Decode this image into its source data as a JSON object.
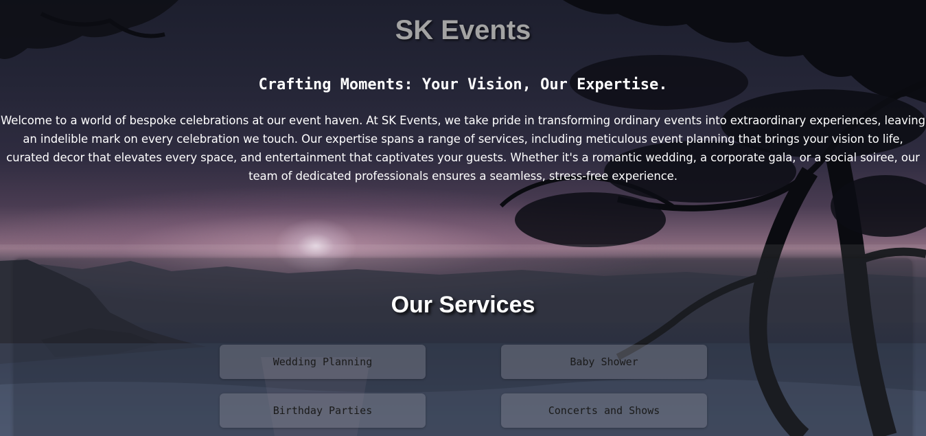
{
  "header": {
    "title": "SK Events"
  },
  "hero": {
    "tagline": "Crafting Moments: Your Vision, Our Expertise.",
    "intro": "Welcome to a world of bespoke celebrations at our event haven. At SK Events, we take pride in transforming ordinary events into extraordinary experiences, leaving an indelible mark on every celebration we touch. Our expertise spans a range of services, including meticulous event planning that brings your vision to life, curated decor that elevates every space, and entertainment that captivates your guests. Whether it's a romantic wedding, a corporate gala, or a social soiree, our team of dedicated professionals ensures a seamless, stress-free experience."
  },
  "services": {
    "title": "Our Services",
    "items": [
      {
        "label": "Wedding Planning"
      },
      {
        "label": "Baby Shower"
      },
      {
        "label": "Birthday Parties"
      },
      {
        "label": "Concerts and Shows"
      }
    ]
  },
  "colors": {
    "title_gray": "#a3a3a3",
    "text_white": "#ffffff",
    "button_text": "#1a1a1a"
  }
}
